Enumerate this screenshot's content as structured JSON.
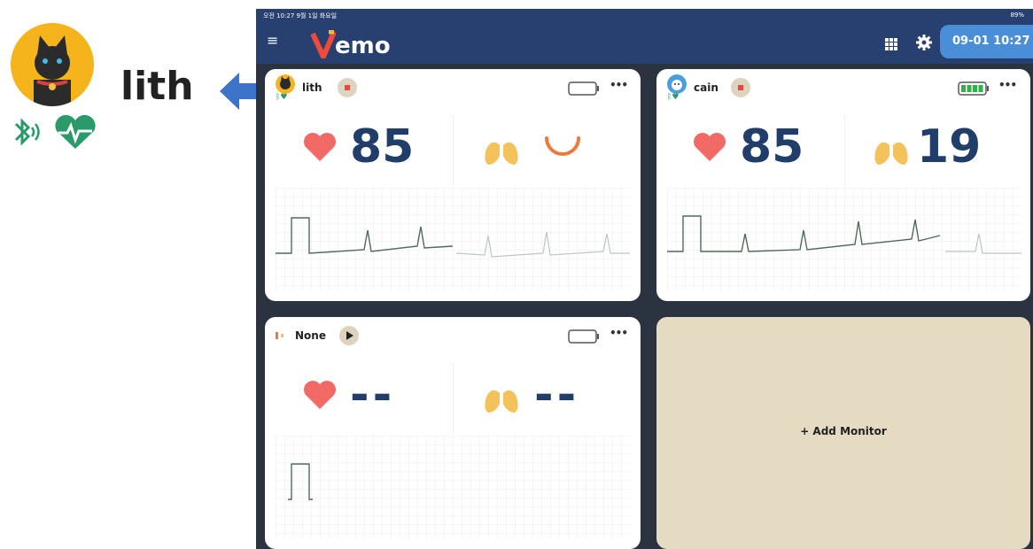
{
  "callout": {
    "name": "lith"
  },
  "statusbar": {
    "left_text": "오전 10:27  9월 1일 화요일",
    "right_text": "89%"
  },
  "appbar": {
    "logo_text": "emo",
    "clock": "09-01 10:27"
  },
  "cards": [
    {
      "name": "lith",
      "heart_rate": "85",
      "resp_rate": "",
      "control": "stop-icon",
      "battery": "empty"
    },
    {
      "name": "cain",
      "heart_rate": "85",
      "resp_rate": "19",
      "control": "stop-icon",
      "battery": "full"
    },
    {
      "name": "None",
      "heart_rate": "--",
      "resp_rate": "--",
      "control": "play-icon",
      "battery": "empty"
    }
  ],
  "add_monitor": {
    "label": "+  Add Monitor"
  },
  "colors": {
    "appbar": "#27406f",
    "background": "#2b3240",
    "heart": "#f26a65",
    "lungs": "#f4c25a",
    "number": "#213d69",
    "clock": "#4a8ed8",
    "add_card": "#e5dbc3",
    "status_green": "#2a9a6a",
    "arrow": "#3d74c9"
  }
}
